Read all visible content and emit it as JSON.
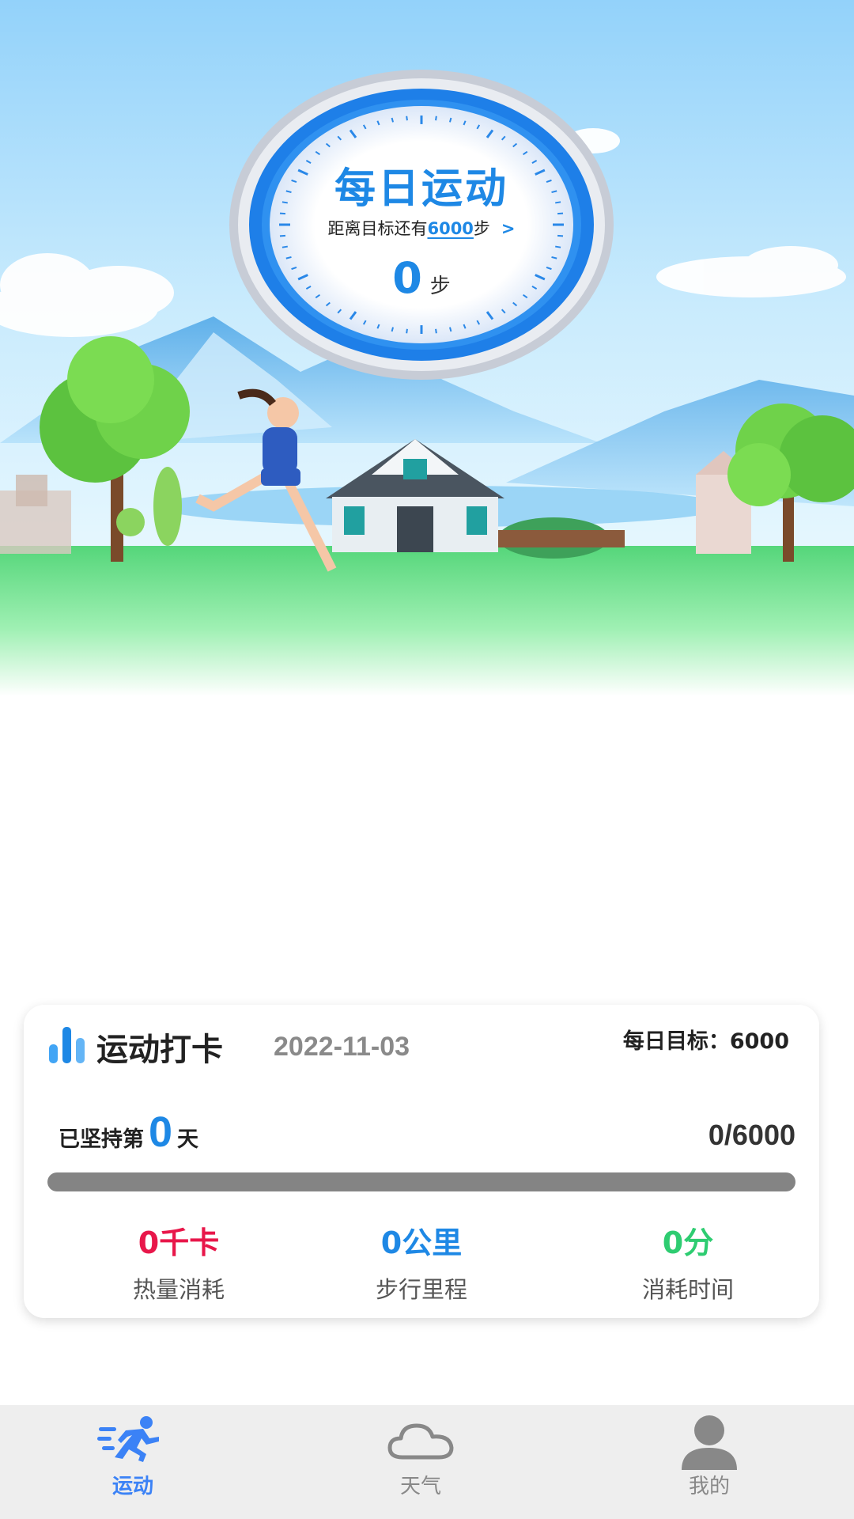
{
  "dial": {
    "title": "每日运动",
    "subtitle_prefix": "距离目标还有",
    "remaining_steps": "6000",
    "subtitle_suffix": "步",
    "arrow": ">",
    "steps": "0",
    "steps_unit": "步"
  },
  "card": {
    "title": "运动打卡",
    "date": "2022-11-03",
    "daily_goal": "每日目标：6000",
    "streak_prefix": "已坚持第",
    "streak_days": "0",
    "streak_suffix": "天",
    "progress_text": "0/6000",
    "progress_fraction": 0,
    "stats": [
      {
        "value": "0千卡",
        "label": "热量消耗",
        "color": "#e8174a"
      },
      {
        "value": "0公里",
        "label": "步行里程",
        "color": "#1e88e5"
      },
      {
        "value": "0分",
        "label": "消耗时间",
        "color": "#2ecc71"
      }
    ]
  },
  "tabbar": {
    "tabs": [
      {
        "label": "运动",
        "icon": "running-person-icon",
        "active": true
      },
      {
        "label": "天气",
        "icon": "cloud-icon",
        "active": false
      },
      {
        "label": "我的",
        "icon": "user-icon",
        "active": false
      }
    ]
  },
  "colors": {
    "accent": "#1e88e5",
    "calorie": "#e8174a",
    "distance": "#1e88e5",
    "time": "#2ecc71",
    "tab_active": "#3b82f6",
    "tab_inactive": "#888888"
  }
}
